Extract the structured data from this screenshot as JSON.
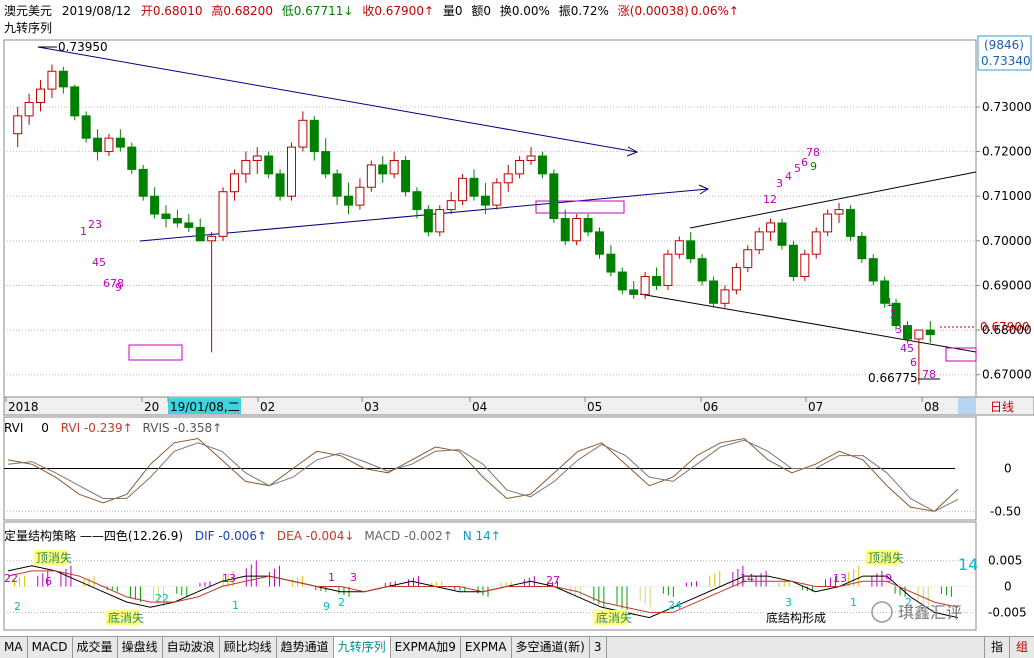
{
  "header": {
    "symbol": "澳元美元",
    "date": "2019/08/12",
    "open_label": "开",
    "open": "0.68010",
    "high_label": "高",
    "high": "0.68200",
    "low_label": "低",
    "low": "0.67711↓",
    "close_label": "收",
    "close": "0.67900↑",
    "vol_label": "量",
    "vol": "0",
    "amount_label": "额",
    "amount": "0",
    "turnover_label": "换",
    "turnover": "0.00%",
    "amplitude_label": "振",
    "amplitude": "0.72%",
    "change_label": "涨",
    "change": "(0.00038)",
    "change_pct": "0.06%↑",
    "indicator": "九转序列",
    "badge_count": "(9846)",
    "badge_price": "0.73340"
  },
  "colors": {
    "up": "#c00000",
    "down": "#008000",
    "trendline": "#000080",
    "td": "#c000c0",
    "dif": "#000000",
    "dea": "#c0392b",
    "rvi": "#8b5a2b"
  },
  "chart_data": [
    {
      "type": "candlestick",
      "name": "price",
      "y_axis_ticks": [
        "0.73000",
        "0.72000",
        "0.71000",
        "0.70000",
        "0.69000",
        "0.68000",
        "0.67000"
      ],
      "ylim": [
        0.665,
        0.745
      ],
      "x_ticks": [
        "2018",
        "20",
        "19/01/08,二",
        "02",
        "03",
        "04",
        "05",
        "06",
        "07",
        "08"
      ],
      "x_right_label": "日线",
      "annotations": {
        "max_label": "0.73950",
        "min_label": "0.66775",
        "last_price": "0.67900"
      },
      "td_counts": [
        "1",
        "23",
        "45",
        "678",
        "9",
        "12",
        "3",
        "4",
        "5",
        "6",
        "78",
        "9",
        "1",
        "2",
        "3",
        "45",
        "6",
        "78"
      ],
      "ohlc": [
        [
          0.724,
          0.73,
          0.721,
          0.728
        ],
        [
          0.728,
          0.733,
          0.726,
          0.731
        ],
        [
          0.731,
          0.736,
          0.729,
          0.734
        ],
        [
          0.734,
          0.7395,
          0.732,
          0.738
        ],
        [
          0.738,
          0.739,
          0.733,
          0.7345
        ],
        [
          0.7345,
          0.735,
          0.727,
          0.728
        ],
        [
          0.728,
          0.729,
          0.722,
          0.723
        ],
        [
          0.723,
          0.725,
          0.718,
          0.72
        ],
        [
          0.72,
          0.724,
          0.719,
          0.723
        ],
        [
          0.723,
          0.725,
          0.72,
          0.721
        ],
        [
          0.721,
          0.722,
          0.715,
          0.716
        ],
        [
          0.716,
          0.717,
          0.709,
          0.71
        ],
        [
          0.71,
          0.712,
          0.705,
          0.706
        ],
        [
          0.706,
          0.708,
          0.703,
          0.705
        ],
        [
          0.705,
          0.707,
          0.703,
          0.704
        ],
        [
          0.704,
          0.706,
          0.702,
          0.703
        ],
        [
          0.703,
          0.705,
          0.701,
          0.7
        ],
        [
          0.7,
          0.702,
          0.675,
          0.701
        ],
        [
          0.701,
          0.712,
          0.7,
          0.711
        ],
        [
          0.711,
          0.716,
          0.709,
          0.715
        ],
        [
          0.715,
          0.72,
          0.713,
          0.718
        ],
        [
          0.718,
          0.721,
          0.715,
          0.719
        ],
        [
          0.719,
          0.72,
          0.714,
          0.715
        ],
        [
          0.715,
          0.716,
          0.709,
          0.71
        ],
        [
          0.71,
          0.722,
          0.709,
          0.721
        ],
        [
          0.721,
          0.729,
          0.72,
          0.727
        ],
        [
          0.727,
          0.728,
          0.718,
          0.72
        ],
        [
          0.72,
          0.723,
          0.714,
          0.715
        ],
        [
          0.715,
          0.716,
          0.708,
          0.71
        ],
        [
          0.71,
          0.713,
          0.706,
          0.708
        ],
        [
          0.708,
          0.714,
          0.707,
          0.712
        ],
        [
          0.712,
          0.718,
          0.711,
          0.717
        ],
        [
          0.717,
          0.719,
          0.713,
          0.715
        ],
        [
          0.715,
          0.72,
          0.714,
          0.718
        ],
        [
          0.718,
          0.719,
          0.71,
          0.711
        ],
        [
          0.711,
          0.712,
          0.705,
          0.707
        ],
        [
          0.707,
          0.708,
          0.701,
          0.702
        ],
        [
          0.702,
          0.708,
          0.701,
          0.707
        ],
        [
          0.707,
          0.711,
          0.706,
          0.709
        ],
        [
          0.709,
          0.715,
          0.708,
          0.714
        ],
        [
          0.714,
          0.716,
          0.709,
          0.71
        ],
        [
          0.71,
          0.713,
          0.706,
          0.708
        ],
        [
          0.708,
          0.714,
          0.707,
          0.713
        ],
        [
          0.713,
          0.717,
          0.711,
          0.715
        ],
        [
          0.715,
          0.719,
          0.714,
          0.718
        ],
        [
          0.718,
          0.721,
          0.717,
          0.719
        ],
        [
          0.719,
          0.72,
          0.714,
          0.715
        ],
        [
          0.715,
          0.716,
          0.704,
          0.705
        ],
        [
          0.705,
          0.707,
          0.699,
          0.7
        ],
        [
          0.7,
          0.706,
          0.699,
          0.705
        ],
        [
          0.705,
          0.706,
          0.701,
          0.702
        ],
        [
          0.702,
          0.703,
          0.696,
          0.697
        ],
        [
          0.697,
          0.699,
          0.692,
          0.693
        ],
        [
          0.693,
          0.694,
          0.688,
          0.689
        ],
        [
          0.689,
          0.691,
          0.687,
          0.688
        ],
        [
          0.688,
          0.693,
          0.687,
          0.692
        ],
        [
          0.692,
          0.694,
          0.689,
          0.69
        ],
        [
          0.69,
          0.698,
          0.689,
          0.697
        ],
        [
          0.697,
          0.701,
          0.696,
          0.7
        ],
        [
          0.7,
          0.702,
          0.695,
          0.696
        ],
        [
          0.696,
          0.697,
          0.69,
          0.691
        ],
        [
          0.691,
          0.692,
          0.685,
          0.686
        ],
        [
          0.686,
          0.69,
          0.685,
          0.689
        ],
        [
          0.689,
          0.695,
          0.688,
          0.694
        ],
        [
          0.694,
          0.699,
          0.693,
          0.698
        ],
        [
          0.698,
          0.703,
          0.697,
          0.702
        ],
        [
          0.702,
          0.705,
          0.7,
          0.704
        ],
        [
          0.704,
          0.705,
          0.698,
          0.699
        ],
        [
          0.699,
          0.7,
          0.691,
          0.692
        ],
        [
          0.692,
          0.698,
          0.691,
          0.697
        ],
        [
          0.697,
          0.703,
          0.696,
          0.702
        ],
        [
          0.702,
          0.707,
          0.701,
          0.706
        ],
        [
          0.706,
          0.7085,
          0.704,
          0.707
        ],
        [
          0.707,
          0.708,
          0.7,
          0.701
        ],
        [
          0.701,
          0.702,
          0.695,
          0.696
        ],
        [
          0.696,
          0.697,
          0.69,
          0.691
        ],
        [
          0.691,
          0.692,
          0.685,
          0.686
        ],
        [
          0.686,
          0.687,
          0.68,
          0.681
        ],
        [
          0.681,
          0.682,
          0.677,
          0.678
        ],
        [
          0.678,
          0.679,
          0.6678,
          0.68
        ],
        [
          0.68,
          0.682,
          0.6771,
          0.679
        ]
      ]
    },
    {
      "type": "line",
      "name": "RVI",
      "labels": {
        "title": "RVI",
        "value0": "0",
        "rvi": "RVI -0.239↑",
        "rvis": "RVIS -0.358↑"
      },
      "y_axis_ticks": [
        "0",
        "-0.50"
      ],
      "ylim": [
        -0.6,
        0.6
      ],
      "series": [
        {
          "name": "RVI",
          "values": [
            0.1,
            0.05,
            -0.1,
            -0.3,
            -0.4,
            -0.3,
            0.05,
            0.3,
            0.35,
            0.1,
            -0.15,
            -0.2,
            0.0,
            0.2,
            0.15,
            0.0,
            -0.05,
            0.1,
            0.25,
            0.2,
            -0.1,
            -0.35,
            -0.3,
            -0.05,
            0.2,
            0.3,
            0.05,
            -0.2,
            -0.1,
            0.15,
            0.3,
            0.35,
            0.1,
            -0.05,
            0.05,
            0.2,
            0.1,
            -0.2,
            -0.45,
            -0.5,
            -0.24
          ]
        },
        {
          "name": "RVIS",
          "values": [
            0.05,
            0.08,
            -0.05,
            -0.2,
            -0.35,
            -0.35,
            -0.1,
            0.2,
            0.3,
            0.2,
            -0.05,
            -0.2,
            -0.1,
            0.1,
            0.18,
            0.08,
            -0.03,
            0.05,
            0.2,
            0.22,
            0.05,
            -0.25,
            -0.33,
            -0.15,
            0.1,
            0.28,
            0.15,
            -0.1,
            -0.15,
            0.05,
            0.25,
            0.33,
            0.2,
            0.0,
            0.0,
            0.15,
            0.15,
            -0.05,
            -0.35,
            -0.5,
            -0.36
          ]
        }
      ]
    },
    {
      "type": "bar",
      "name": "MACD",
      "labels": {
        "title": "定量结构策略",
        "four_color": "——四色(12.26.9)",
        "dif": "DIF -0.006↑",
        "dea": "DEA -0.004↓",
        "macd": "MACD -0.002↑",
        "n": "N 14↑"
      },
      "y_axis_ticks": [
        "0.005",
        "0",
        "-0.005"
      ],
      "ylim": [
        -0.008,
        0.008
      ],
      "annotations": [
        "顶消失",
        "底消失",
        "顶消失",
        "底消失",
        "底结构形成",
        "14"
      ],
      "numbers": [
        "22",
        "6",
        "2",
        "22",
        "1",
        "13",
        "9",
        "2",
        "1",
        "3",
        "27",
        "24",
        "14",
        "3",
        "13",
        "9",
        "1",
        "2"
      ],
      "values": [
        0.002,
        0.003,
        0.004,
        0.002,
        -0.001,
        -0.003,
        -0.004,
        -0.002,
        0.001,
        0.003,
        0.005,
        0.004,
        0.002,
        -0.001,
        -0.002,
        0.0,
        0.001,
        0.002,
        0.001,
        -0.001,
        -0.002,
        0.001,
        0.002,
        0.001,
        -0.002,
        -0.004,
        -0.005,
        -0.004,
        -0.002,
        0.001,
        0.003,
        0.004,
        0.003,
        0.001,
        -0.001,
        0.002,
        0.004,
        0.003,
        -0.002,
        -0.004,
        -0.002
      ],
      "dif": [
        0.003,
        0.004,
        0.003,
        0.001,
        -0.001,
        -0.003,
        -0.004,
        -0.003,
        -0.001,
        0.001,
        0.002,
        0.002,
        0.001,
        0.0,
        -0.001,
        -0.001,
        0.0,
        0.001,
        0.0,
        -0.001,
        -0.001,
        0.0,
        0.001,
        0.0,
        -0.002,
        -0.004,
        -0.005,
        -0.006,
        -0.004,
        -0.002,
        0.0,
        0.002,
        0.002,
        0.001,
        -0.001,
        0.0,
        0.002,
        0.002,
        -0.002,
        -0.005,
        -0.006
      ],
      "dea": [
        0.002,
        0.003,
        0.003,
        0.002,
        0.0,
        -0.002,
        -0.003,
        -0.003,
        -0.002,
        0.0,
        0.001,
        0.002,
        0.001,
        0.0,
        0.0,
        -0.001,
        0.0,
        0.0,
        0.0,
        0.0,
        -0.001,
        0.0,
        0.0,
        0.0,
        -0.001,
        -0.003,
        -0.004,
        -0.005,
        -0.005,
        -0.003,
        -0.001,
        0.001,
        0.001,
        0.001,
        0.0,
        0.0,
        0.001,
        0.001,
        -0.001,
        -0.003,
        -0.004
      ]
    }
  ],
  "tabs": [
    "MA",
    "MACD",
    "成交量",
    "操盘线",
    "自动波浪",
    "顾比均线",
    "趋势通道",
    "九转序列",
    "EXPMA加9",
    "EXPMA",
    "多空通道(新)",
    "3"
  ],
  "active_tab": "九转序列",
  "tabs_right": [
    "指",
    "组"
  ],
  "watermark": "琪鑫汇评"
}
